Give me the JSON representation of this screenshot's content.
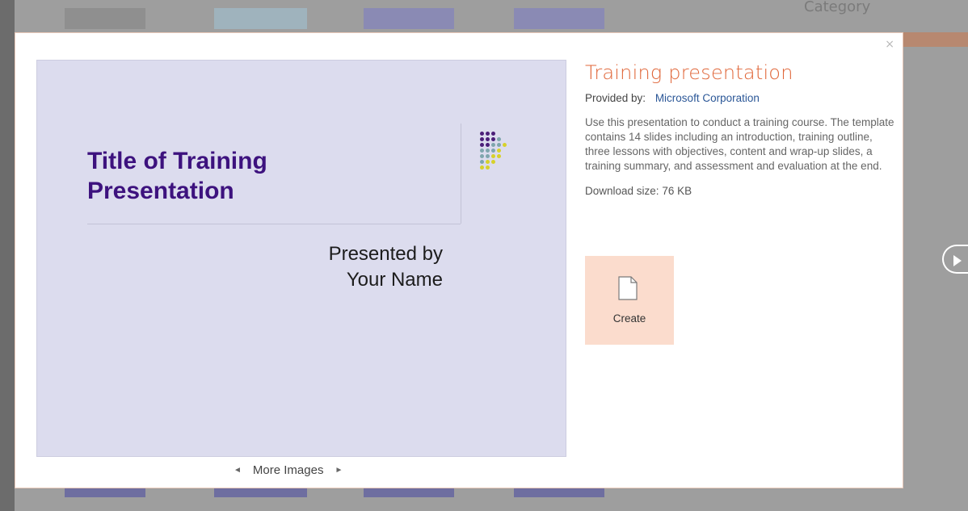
{
  "background": {
    "category_label": "Category"
  },
  "dialog": {
    "close_glyph": "×",
    "preview": {
      "slide_title": "Title of Training Presentation",
      "slide_subtitle_line1": "Presented by",
      "slide_subtitle_line2": "Your Name",
      "more_images_label": "More Images",
      "prev_glyph": "◄",
      "next_glyph": "►"
    },
    "info": {
      "title": "Training presentation",
      "provided_by_label": "Provided by:",
      "provider": "Microsoft Corporation",
      "description": "Use this presentation to conduct a training course. The template contains 14 slides including an introduction, training outline, three lessons with objectives, content and wrap-up slides, a training summary, and assessment and evaluation at the end.",
      "download_size_label": "Download size:",
      "download_size": "76 KB",
      "create_label": "Create"
    }
  },
  "colors": {
    "accent": "#e0673a",
    "link": "#2b5797",
    "slide_title": "#3d127e",
    "slide_bg": "#dcdcee",
    "create_bg": "#fbdccd",
    "dot_purple": "#4b1f79",
    "dot_teal": "#7fa6ad",
    "dot_yellow": "#d7d12a"
  }
}
